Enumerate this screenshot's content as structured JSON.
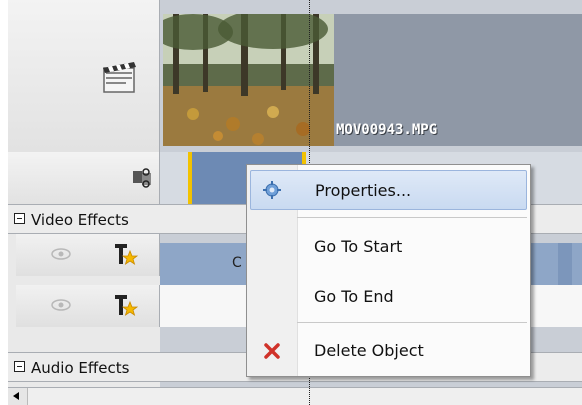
{
  "timeline": {
    "clip_filename": "MOV00943.MPG",
    "effect_clip_label": "C"
  },
  "sections": {
    "video_effects": "Video Effects",
    "audio_effects": "Audio Effects"
  },
  "context_menu": {
    "items": [
      {
        "label": "Properties...",
        "icon": "gear-icon",
        "highlighted": true
      },
      {
        "label": "Go To Start",
        "icon": ""
      },
      {
        "label": "Go To End",
        "icon": ""
      },
      {
        "label": "Delete Object",
        "icon": "delete-x-icon"
      }
    ]
  },
  "colors": {
    "menu_highlight": "#c9daf1",
    "delete_icon": "#d0322a",
    "transition_border": "#f2c200",
    "effect_bar": "#8ea6c7"
  }
}
